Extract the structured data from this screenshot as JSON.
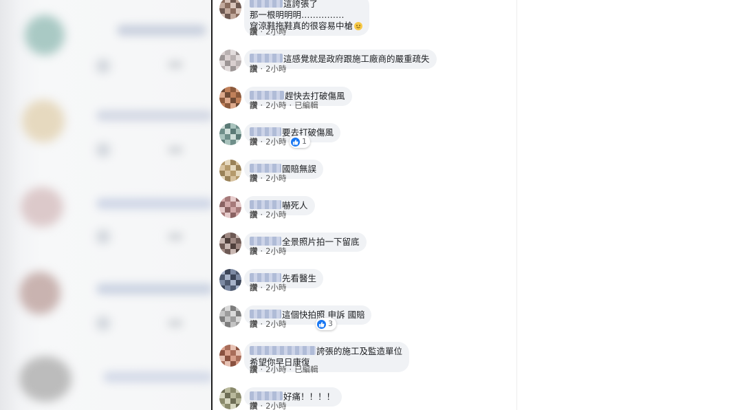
{
  "comments": [
    {
      "lines": [
        "這誇張了",
        "那一根明明明……………",
        "穿涼鞋拖鞋真的很容易中槍"
      ],
      "like": "讚",
      "time": "2小時",
      "edited": "",
      "reactions": "",
      "emoji": "smiling-face"
    },
    {
      "lines": [
        "這感覺就是政府跟施工廠商的嚴重疏失"
      ],
      "like": "讚",
      "time": "2小時",
      "edited": "",
      "reactions": ""
    },
    {
      "lines": [
        "趕快去打破傷風"
      ],
      "like": "讚",
      "time": "2小時",
      "edited": "已編輯",
      "reactions": ""
    },
    {
      "lines": [
        "要去打破傷風"
      ],
      "like": "讚",
      "time": "2小時",
      "edited": "",
      "reactions": "1"
    },
    {
      "lines": [
        "國賠無誤"
      ],
      "like": "讚",
      "time": "2小時",
      "edited": "",
      "reactions": ""
    },
    {
      "lines": [
        "嚇死人"
      ],
      "like": "讚",
      "time": "2小時",
      "edited": "",
      "reactions": ""
    },
    {
      "lines": [
        "全景照片拍一下留底"
      ],
      "like": "讚",
      "time": "2小時",
      "edited": "",
      "reactions": ""
    },
    {
      "lines": [
        "先看醫生"
      ],
      "like": "讚",
      "time": "2小時",
      "edited": "",
      "reactions": ""
    },
    {
      "lines": [
        "這個快拍照 申訴 國賠"
      ],
      "like": "讚",
      "time": "2小時",
      "edited": "",
      "reactions": "3"
    },
    {
      "lines": [
        "誇張的施工及監造單位",
        "希望你早日康復"
      ],
      "like": "讚",
      "time": "2小時",
      "edited": "已編輯",
      "reactions": ""
    },
    {
      "lines": [
        "好痛！！！！"
      ],
      "like": "讚",
      "time": "2小時",
      "edited": "",
      "reactions": ""
    }
  ],
  "icons": {
    "reaction": "like-icon",
    "emoji": "smiling-face-emoji"
  },
  "colors": {
    "bubble": "#f0f2f5",
    "like_blue": "#1877f2",
    "name_blur": "#a9b6d4"
  }
}
